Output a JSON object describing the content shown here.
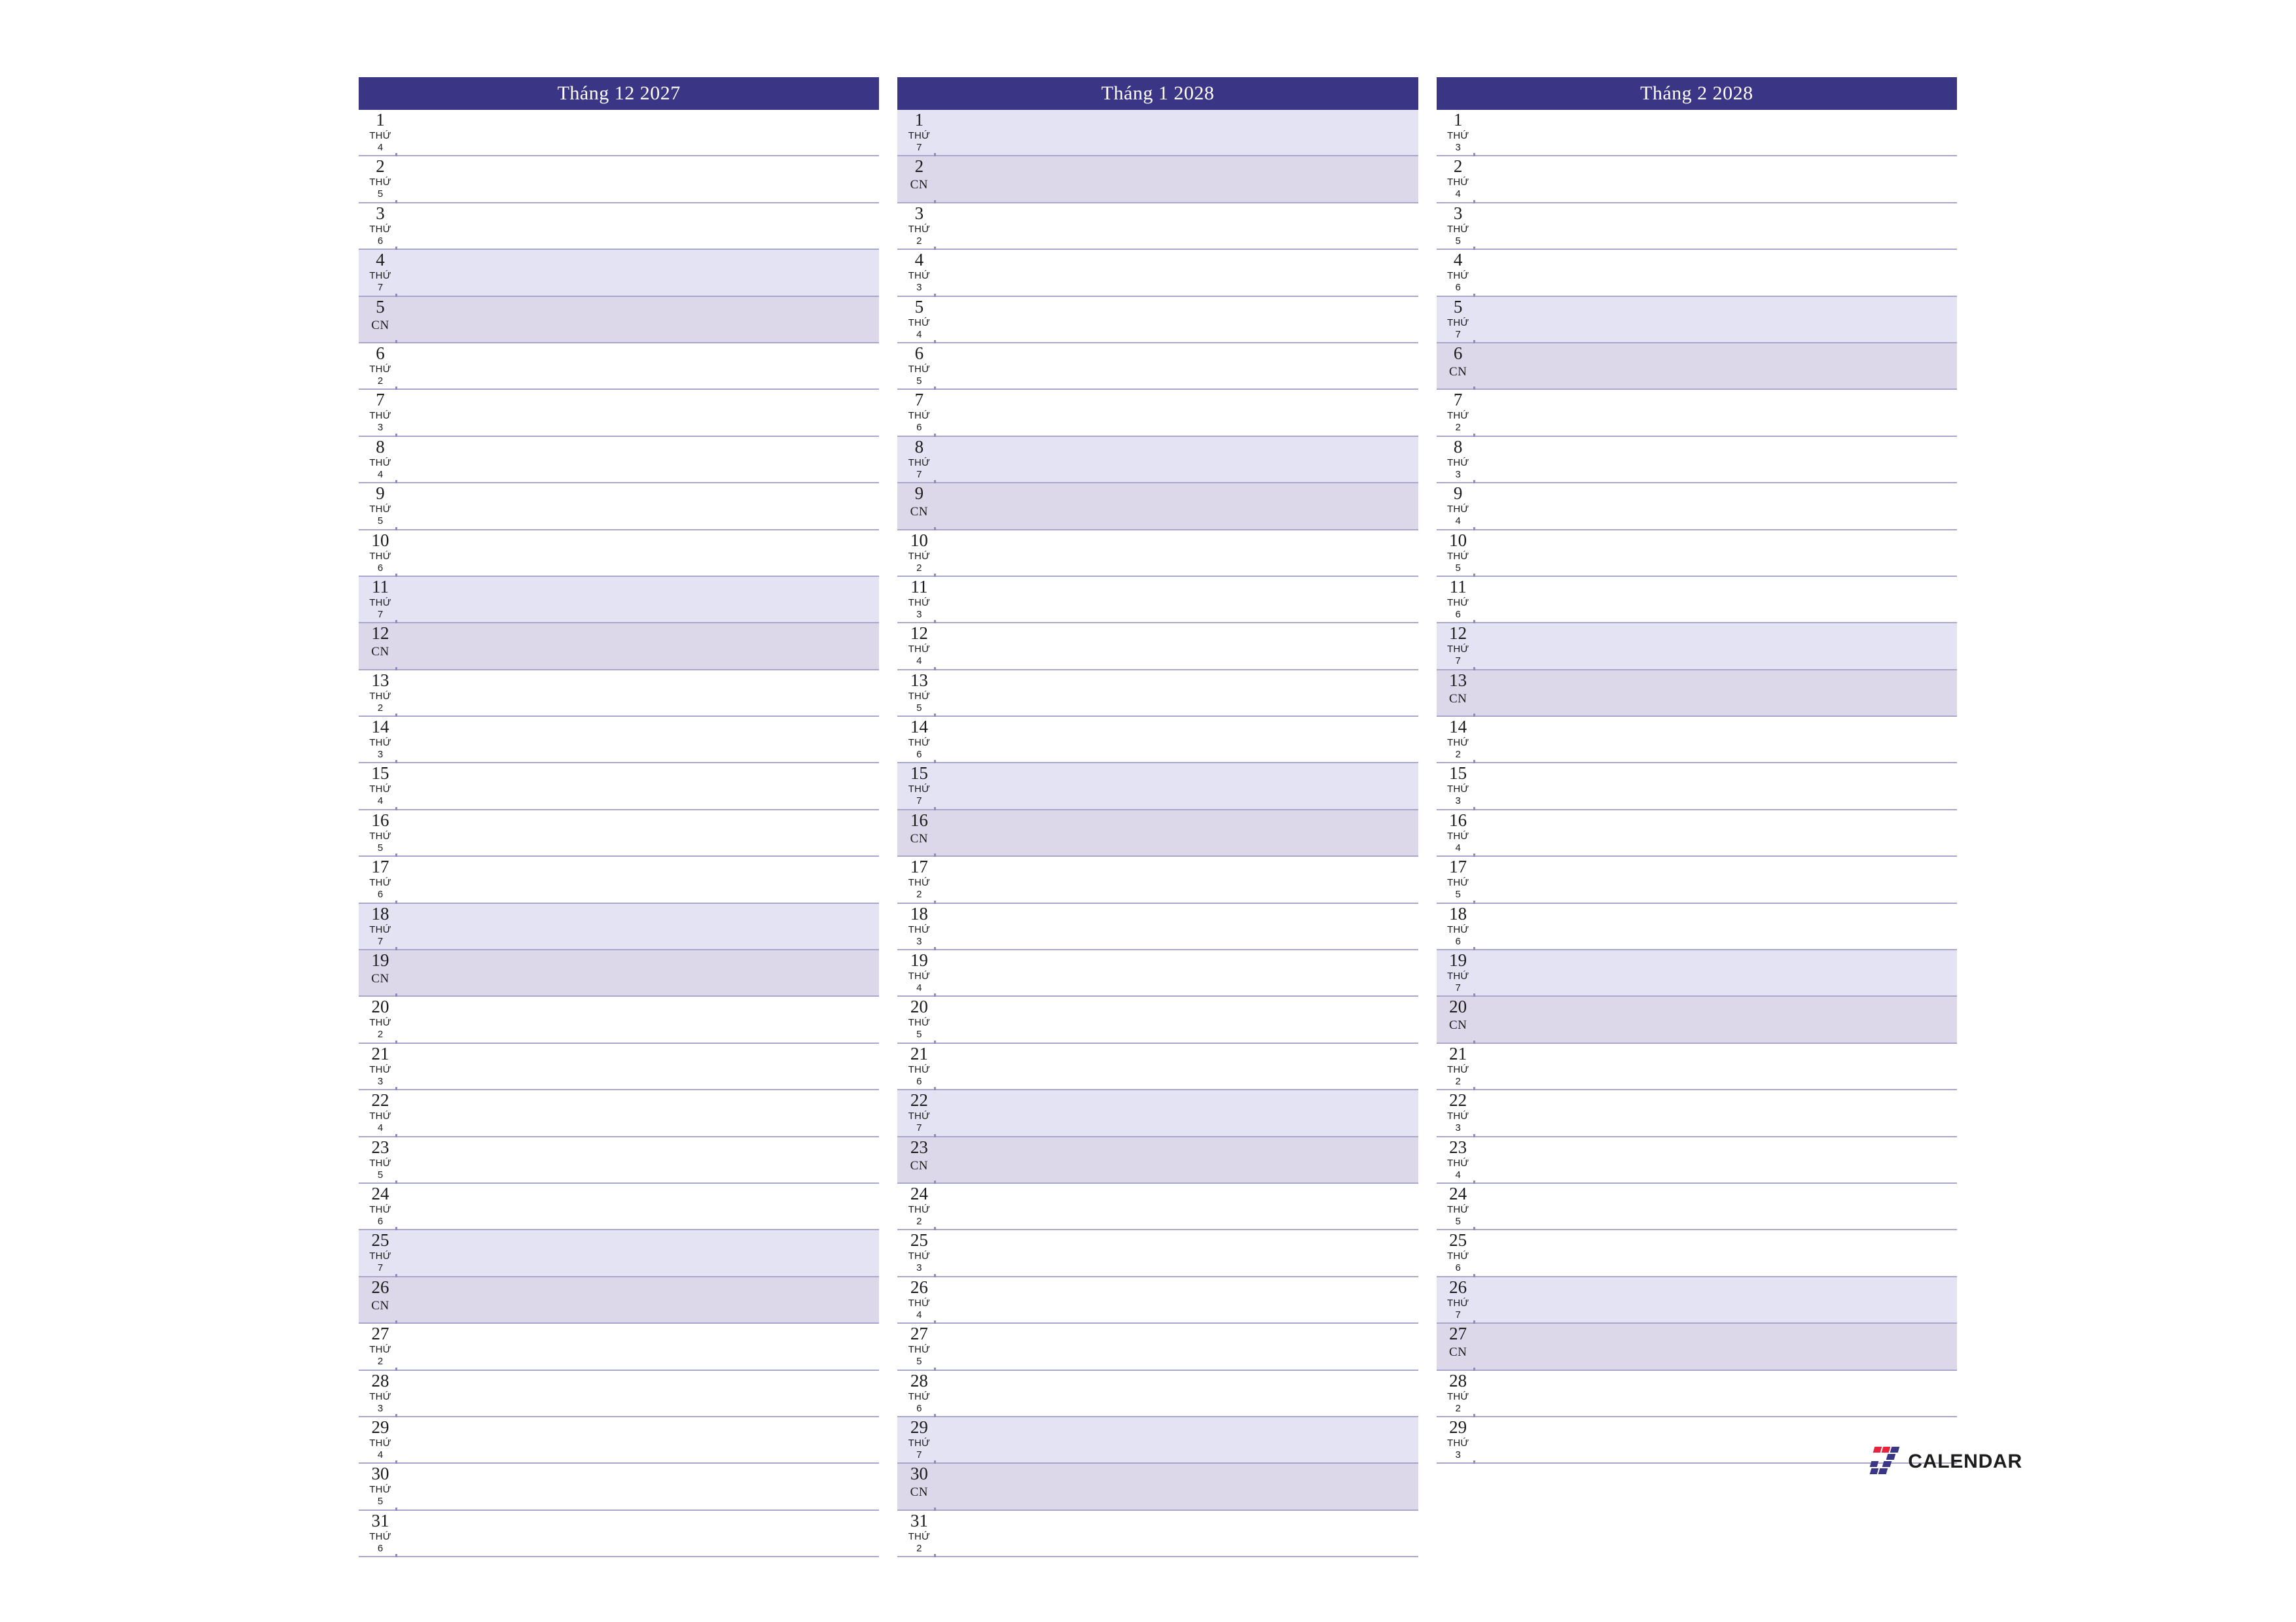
{
  "document": {
    "kind": "printable-monthly-planner",
    "language": "vi",
    "orientation": "landscape",
    "weekday_word": "THỨ",
    "sunday_label": "CN"
  },
  "brand": {
    "logo_icon": "seven-calendar-logo-icon",
    "mark_glyph": "7",
    "wordmark": "CALENDAR",
    "mark_color_primary": "#3b3585",
    "mark_color_accent": "#e8243c",
    "wordmark_color": "#1c1c1c"
  },
  "colors": {
    "header_bg": "#3b3585",
    "header_text": "#ffffff",
    "saturday_bg": "#e3e3f4",
    "sunday_bg": "#dcd8e9",
    "weekday_bg": "#ffffff",
    "row_rule": "#a9a6cd",
    "text": "#1a1a1a"
  },
  "months": [
    {
      "title": "Tháng 12 2027",
      "month_name": "Tháng 12",
      "month_number": 12,
      "year": 2027,
      "day_count": 31,
      "first_weekday": "THỨ 4",
      "weekend_days": [
        4,
        5,
        11,
        12,
        18,
        19,
        25,
        26
      ],
      "days": [
        {
          "num": "1",
          "dow_word": "THỨ",
          "dow_num": "4",
          "type": "weekday"
        },
        {
          "num": "2",
          "dow_word": "THỨ",
          "dow_num": "5",
          "type": "weekday"
        },
        {
          "num": "3",
          "dow_word": "THỨ",
          "dow_num": "6",
          "type": "weekday"
        },
        {
          "num": "4",
          "dow_word": "THỨ",
          "dow_num": "7",
          "type": "sat"
        },
        {
          "num": "5",
          "dow_word": "CN",
          "dow_num": "",
          "type": "sun"
        },
        {
          "num": "6",
          "dow_word": "THỨ",
          "dow_num": "2",
          "type": "weekday"
        },
        {
          "num": "7",
          "dow_word": "THỨ",
          "dow_num": "3",
          "type": "weekday"
        },
        {
          "num": "8",
          "dow_word": "THỨ",
          "dow_num": "4",
          "type": "weekday"
        },
        {
          "num": "9",
          "dow_word": "THỨ",
          "dow_num": "5",
          "type": "weekday"
        },
        {
          "num": "10",
          "dow_word": "THỨ",
          "dow_num": "6",
          "type": "weekday"
        },
        {
          "num": "11",
          "dow_word": "THỨ",
          "dow_num": "7",
          "type": "sat"
        },
        {
          "num": "12",
          "dow_word": "CN",
          "dow_num": "",
          "type": "sun"
        },
        {
          "num": "13",
          "dow_word": "THỨ",
          "dow_num": "2",
          "type": "weekday"
        },
        {
          "num": "14",
          "dow_word": "THỨ",
          "dow_num": "3",
          "type": "weekday"
        },
        {
          "num": "15",
          "dow_word": "THỨ",
          "dow_num": "4",
          "type": "weekday"
        },
        {
          "num": "16",
          "dow_word": "THỨ",
          "dow_num": "5",
          "type": "weekday"
        },
        {
          "num": "17",
          "dow_word": "THỨ",
          "dow_num": "6",
          "type": "weekday"
        },
        {
          "num": "18",
          "dow_word": "THỨ",
          "dow_num": "7",
          "type": "sat"
        },
        {
          "num": "19",
          "dow_word": "CN",
          "dow_num": "",
          "type": "sun"
        },
        {
          "num": "20",
          "dow_word": "THỨ",
          "dow_num": "2",
          "type": "weekday"
        },
        {
          "num": "21",
          "dow_word": "THỨ",
          "dow_num": "3",
          "type": "weekday"
        },
        {
          "num": "22",
          "dow_word": "THỨ",
          "dow_num": "4",
          "type": "weekday"
        },
        {
          "num": "23",
          "dow_word": "THỨ",
          "dow_num": "5",
          "type": "weekday"
        },
        {
          "num": "24",
          "dow_word": "THỨ",
          "dow_num": "6",
          "type": "weekday"
        },
        {
          "num": "25",
          "dow_word": "THỨ",
          "dow_num": "7",
          "type": "sat"
        },
        {
          "num": "26",
          "dow_word": "CN",
          "dow_num": "",
          "type": "sun"
        },
        {
          "num": "27",
          "dow_word": "THỨ",
          "dow_num": "2",
          "type": "weekday"
        },
        {
          "num": "28",
          "dow_word": "THỨ",
          "dow_num": "3",
          "type": "weekday"
        },
        {
          "num": "29",
          "dow_word": "THỨ",
          "dow_num": "4",
          "type": "weekday"
        },
        {
          "num": "30",
          "dow_word": "THỨ",
          "dow_num": "5",
          "type": "weekday"
        },
        {
          "num": "31",
          "dow_word": "THỨ",
          "dow_num": "6",
          "type": "weekday"
        }
      ]
    },
    {
      "title": "Tháng 1 2028",
      "month_name": "Tháng 1",
      "month_number": 1,
      "year": 2028,
      "day_count": 31,
      "first_weekday": "THỨ 7",
      "weekend_days": [
        1,
        2,
        8,
        9,
        15,
        16,
        22,
        23,
        29,
        30
      ],
      "days": [
        {
          "num": "1",
          "dow_word": "THỨ",
          "dow_num": "7",
          "type": "sat"
        },
        {
          "num": "2",
          "dow_word": "CN",
          "dow_num": "",
          "type": "sun"
        },
        {
          "num": "3",
          "dow_word": "THỨ",
          "dow_num": "2",
          "type": "weekday"
        },
        {
          "num": "4",
          "dow_word": "THỨ",
          "dow_num": "3",
          "type": "weekday"
        },
        {
          "num": "5",
          "dow_word": "THỨ",
          "dow_num": "4",
          "type": "weekday"
        },
        {
          "num": "6",
          "dow_word": "THỨ",
          "dow_num": "5",
          "type": "weekday"
        },
        {
          "num": "7",
          "dow_word": "THỨ",
          "dow_num": "6",
          "type": "weekday"
        },
        {
          "num": "8",
          "dow_word": "THỨ",
          "dow_num": "7",
          "type": "sat"
        },
        {
          "num": "9",
          "dow_word": "CN",
          "dow_num": "",
          "type": "sun"
        },
        {
          "num": "10",
          "dow_word": "THỨ",
          "dow_num": "2",
          "type": "weekday"
        },
        {
          "num": "11",
          "dow_word": "THỨ",
          "dow_num": "3",
          "type": "weekday"
        },
        {
          "num": "12",
          "dow_word": "THỨ",
          "dow_num": "4",
          "type": "weekday"
        },
        {
          "num": "13",
          "dow_word": "THỨ",
          "dow_num": "5",
          "type": "weekday"
        },
        {
          "num": "14",
          "dow_word": "THỨ",
          "dow_num": "6",
          "type": "weekday"
        },
        {
          "num": "15",
          "dow_word": "THỨ",
          "dow_num": "7",
          "type": "sat"
        },
        {
          "num": "16",
          "dow_word": "CN",
          "dow_num": "",
          "type": "sun"
        },
        {
          "num": "17",
          "dow_word": "THỨ",
          "dow_num": "2",
          "type": "weekday"
        },
        {
          "num": "18",
          "dow_word": "THỨ",
          "dow_num": "3",
          "type": "weekday"
        },
        {
          "num": "19",
          "dow_word": "THỨ",
          "dow_num": "4",
          "type": "weekday"
        },
        {
          "num": "20",
          "dow_word": "THỨ",
          "dow_num": "5",
          "type": "weekday"
        },
        {
          "num": "21",
          "dow_word": "THỨ",
          "dow_num": "6",
          "type": "weekday"
        },
        {
          "num": "22",
          "dow_word": "THỨ",
          "dow_num": "7",
          "type": "sat"
        },
        {
          "num": "23",
          "dow_word": "CN",
          "dow_num": "",
          "type": "sun"
        },
        {
          "num": "24",
          "dow_word": "THỨ",
          "dow_num": "2",
          "type": "weekday"
        },
        {
          "num": "25",
          "dow_word": "THỨ",
          "dow_num": "3",
          "type": "weekday"
        },
        {
          "num": "26",
          "dow_word": "THỨ",
          "dow_num": "4",
          "type": "weekday"
        },
        {
          "num": "27",
          "dow_word": "THỨ",
          "dow_num": "5",
          "type": "weekday"
        },
        {
          "num": "28",
          "dow_word": "THỨ",
          "dow_num": "6",
          "type": "weekday"
        },
        {
          "num": "29",
          "dow_word": "THỨ",
          "dow_num": "7",
          "type": "sat"
        },
        {
          "num": "30",
          "dow_word": "CN",
          "dow_num": "",
          "type": "sun"
        },
        {
          "num": "31",
          "dow_word": "THỨ",
          "dow_num": "2",
          "type": "weekday"
        }
      ]
    },
    {
      "title": "Tháng 2 2028",
      "month_name": "Tháng 2",
      "month_number": 2,
      "year": 2028,
      "day_count": 29,
      "first_weekday": "THỨ 3",
      "weekend_days": [
        5,
        6,
        12,
        13,
        19,
        20,
        26,
        27
      ],
      "days": [
        {
          "num": "1",
          "dow_word": "THỨ",
          "dow_num": "3",
          "type": "weekday"
        },
        {
          "num": "2",
          "dow_word": "THỨ",
          "dow_num": "4",
          "type": "weekday"
        },
        {
          "num": "3",
          "dow_word": "THỨ",
          "dow_num": "5",
          "type": "weekday"
        },
        {
          "num": "4",
          "dow_word": "THỨ",
          "dow_num": "6",
          "type": "weekday"
        },
        {
          "num": "5",
          "dow_word": "THỨ",
          "dow_num": "7",
          "type": "sat"
        },
        {
          "num": "6",
          "dow_word": "CN",
          "dow_num": "",
          "type": "sun"
        },
        {
          "num": "7",
          "dow_word": "THỨ",
          "dow_num": "2",
          "type": "weekday"
        },
        {
          "num": "8",
          "dow_word": "THỨ",
          "dow_num": "3",
          "type": "weekday"
        },
        {
          "num": "9",
          "dow_word": "THỨ",
          "dow_num": "4",
          "type": "weekday"
        },
        {
          "num": "10",
          "dow_word": "THỨ",
          "dow_num": "5",
          "type": "weekday"
        },
        {
          "num": "11",
          "dow_word": "THỨ",
          "dow_num": "6",
          "type": "weekday"
        },
        {
          "num": "12",
          "dow_word": "THỨ",
          "dow_num": "7",
          "type": "sat"
        },
        {
          "num": "13",
          "dow_word": "CN",
          "dow_num": "",
          "type": "sun"
        },
        {
          "num": "14",
          "dow_word": "THỨ",
          "dow_num": "2",
          "type": "weekday"
        },
        {
          "num": "15",
          "dow_word": "THỨ",
          "dow_num": "3",
          "type": "weekday"
        },
        {
          "num": "16",
          "dow_word": "THỨ",
          "dow_num": "4",
          "type": "weekday"
        },
        {
          "num": "17",
          "dow_word": "THỨ",
          "dow_num": "5",
          "type": "weekday"
        },
        {
          "num": "18",
          "dow_word": "THỨ",
          "dow_num": "6",
          "type": "weekday"
        },
        {
          "num": "19",
          "dow_word": "THỨ",
          "dow_num": "7",
          "type": "sat"
        },
        {
          "num": "20",
          "dow_word": "CN",
          "dow_num": "",
          "type": "sun"
        },
        {
          "num": "21",
          "dow_word": "THỨ",
          "dow_num": "2",
          "type": "weekday"
        },
        {
          "num": "22",
          "dow_word": "THỨ",
          "dow_num": "3",
          "type": "weekday"
        },
        {
          "num": "23",
          "dow_word": "THỨ",
          "dow_num": "4",
          "type": "weekday"
        },
        {
          "num": "24",
          "dow_word": "THỨ",
          "dow_num": "5",
          "type": "weekday"
        },
        {
          "num": "25",
          "dow_word": "THỨ",
          "dow_num": "6",
          "type": "weekday"
        },
        {
          "num": "26",
          "dow_word": "THỨ",
          "dow_num": "7",
          "type": "sat"
        },
        {
          "num": "27",
          "dow_word": "CN",
          "dow_num": "",
          "type": "sun"
        },
        {
          "num": "28",
          "dow_word": "THỨ",
          "dow_num": "2",
          "type": "weekday"
        },
        {
          "num": "29",
          "dow_word": "THỨ",
          "dow_num": "3",
          "type": "weekday"
        }
      ]
    }
  ]
}
